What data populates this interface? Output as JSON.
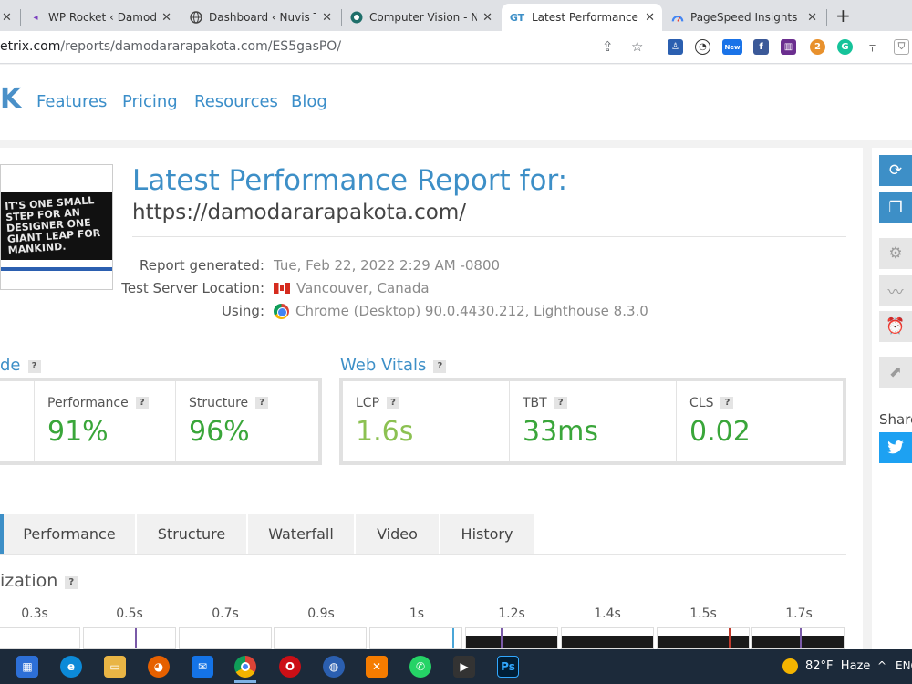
{
  "browser": {
    "tabs": [
      {
        "title": "",
        "icon": "unknown-icon"
      },
      {
        "title": "WP Rocket ‹ Damodar",
        "icon": "wprocket-icon"
      },
      {
        "title": "Dashboard ‹ Nuvis Tec",
        "icon": "globe-icon"
      },
      {
        "title": "Computer Vision - Ne",
        "icon": "circle-logo-icon"
      },
      {
        "title": "Latest Performance Re",
        "icon": "gtmetrix-icon",
        "active": true
      },
      {
        "title": "PageSpeed Insights",
        "icon": "pagespeed-icon"
      }
    ],
    "url_host": "etrix.com",
    "url_path": "/reports/damodararapakota.com/ES5gasPO/",
    "ext_badges": {
      "new": "New",
      "count": "2"
    }
  },
  "nav": {
    "logo": "K",
    "links": [
      "Features",
      "Pricing",
      "Resources",
      "Blog"
    ]
  },
  "report": {
    "title": "Latest Performance Report for:",
    "url": "https://damodararapakota.com/",
    "thumb_text": "IT'S ONE SMALL STEP FOR AN DESIGNER ONE GIANT LEAP FOR MANKIND.",
    "meta": [
      {
        "label": "Report generated:",
        "value": "Tue, Feb 22, 2022 2:29 AM -0800"
      },
      {
        "label": "Test Server Location:",
        "value": "Vancouver, Canada"
      },
      {
        "label": "Using:",
        "value": "Chrome (Desktop) 90.0.4430.212, Lighthouse 8.3.0"
      }
    ]
  },
  "grade": {
    "title": "de",
    "help": "?",
    "metrics": [
      {
        "label": "Performance",
        "value": "91%"
      },
      {
        "label": "Structure",
        "value": "96%"
      }
    ]
  },
  "vitals": {
    "title": "Web Vitals",
    "help": "?",
    "metrics": [
      {
        "label": "LCP",
        "value": "1.6s"
      },
      {
        "label": "TBT",
        "value": "33ms"
      },
      {
        "label": "CLS",
        "value": "0.02"
      }
    ]
  },
  "report_tabs": [
    "Performance",
    "Structure",
    "Waterfall",
    "Video",
    "History"
  ],
  "visualization": {
    "title": "ization",
    "help": "?",
    "ticks": [
      "0.3s",
      "0.5s",
      "0.7s",
      "0.9s",
      "1s",
      "1.2s",
      "1.4s",
      "1.5s",
      "1.7s"
    ]
  },
  "sidebar": {
    "share_label": "Share"
  },
  "taskbar": {
    "temperature": "82°F",
    "condition": "Haze",
    "lang": "ENG"
  },
  "colors": {
    "accent": "#3d8fc7",
    "grade_green": "#3aa63a",
    "lcp_green": "#8cc152",
    "taskbar": "#1c2a3a"
  }
}
